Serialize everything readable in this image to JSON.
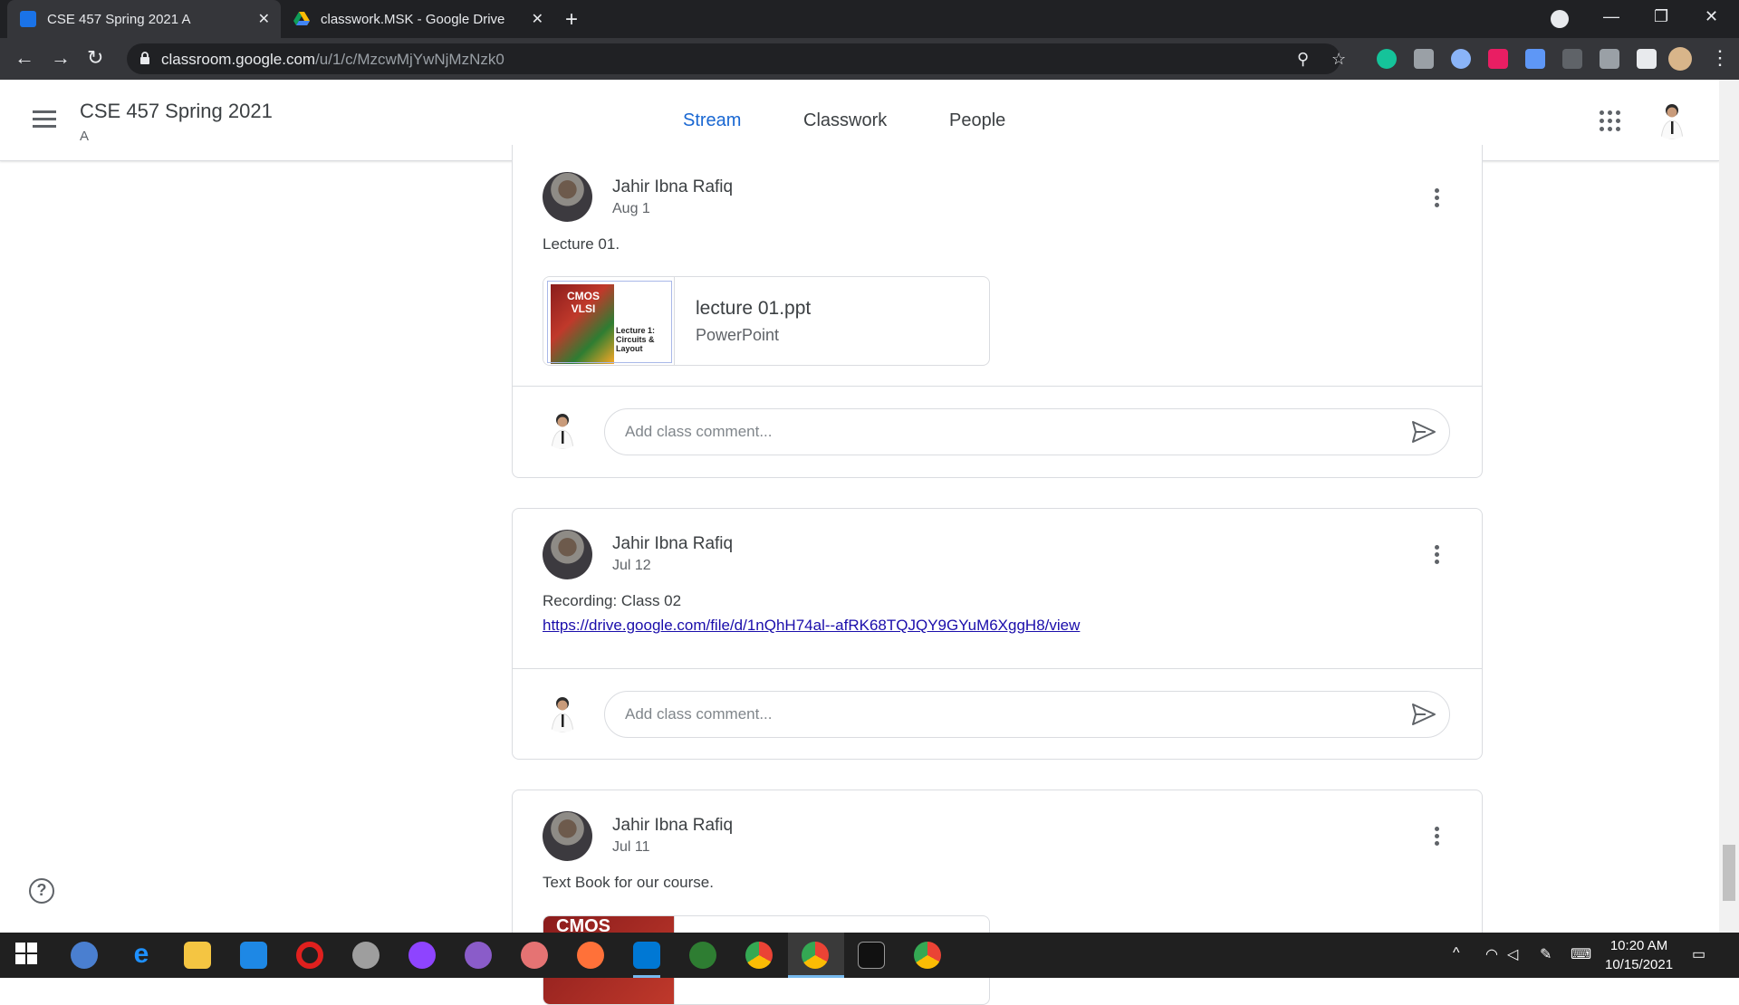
{
  "browser": {
    "tabs": [
      {
        "title": "CSE 457 Spring 2021 A",
        "active": true
      },
      {
        "title": "classwork.MSK - Google Drive",
        "active": false
      }
    ],
    "url_host": "classroom.google.com",
    "url_path": "/u/1/c/MzcwMjYwNjMzNzk0"
  },
  "header": {
    "course_title": "CSE 457 Spring 2021",
    "section": "A",
    "tabs": [
      "Stream",
      "Classwork",
      "People"
    ],
    "active_tab": "Stream"
  },
  "posts": [
    {
      "author": "Jahir Ibna Rafiq",
      "date": "Aug 1",
      "text": "Lecture 01.",
      "attachment": {
        "title": "lecture 01.ppt",
        "type": "PowerPoint",
        "thumb_top": "CMOS VLSI",
        "thumb_caption": "Lecture 1: Circuits & Layout"
      },
      "comment_placeholder": "Add class comment..."
    },
    {
      "author": "Jahir Ibna Rafiq",
      "date": "Jul 12",
      "text": "Recording: Class 02",
      "link": "https://drive.google.com/file/d/1nQhH74al--afRK68TQJQY9GYuM6XggH8/view",
      "comment_placeholder": "Add class comment..."
    },
    {
      "author": "Jahir Ibna Rafiq",
      "date": "Jul 11",
      "text": "Text Book for our course.",
      "attachment": {
        "thumb_top": "CMOS"
      }
    }
  ],
  "taskbar": {
    "time": "10:20 AM",
    "date": "10/15/2021"
  },
  "colors": {
    "accent": "#1967d2",
    "chrome_dark": "#202124",
    "chrome_toolbar": "#35363a",
    "link": "#1a0dab"
  }
}
